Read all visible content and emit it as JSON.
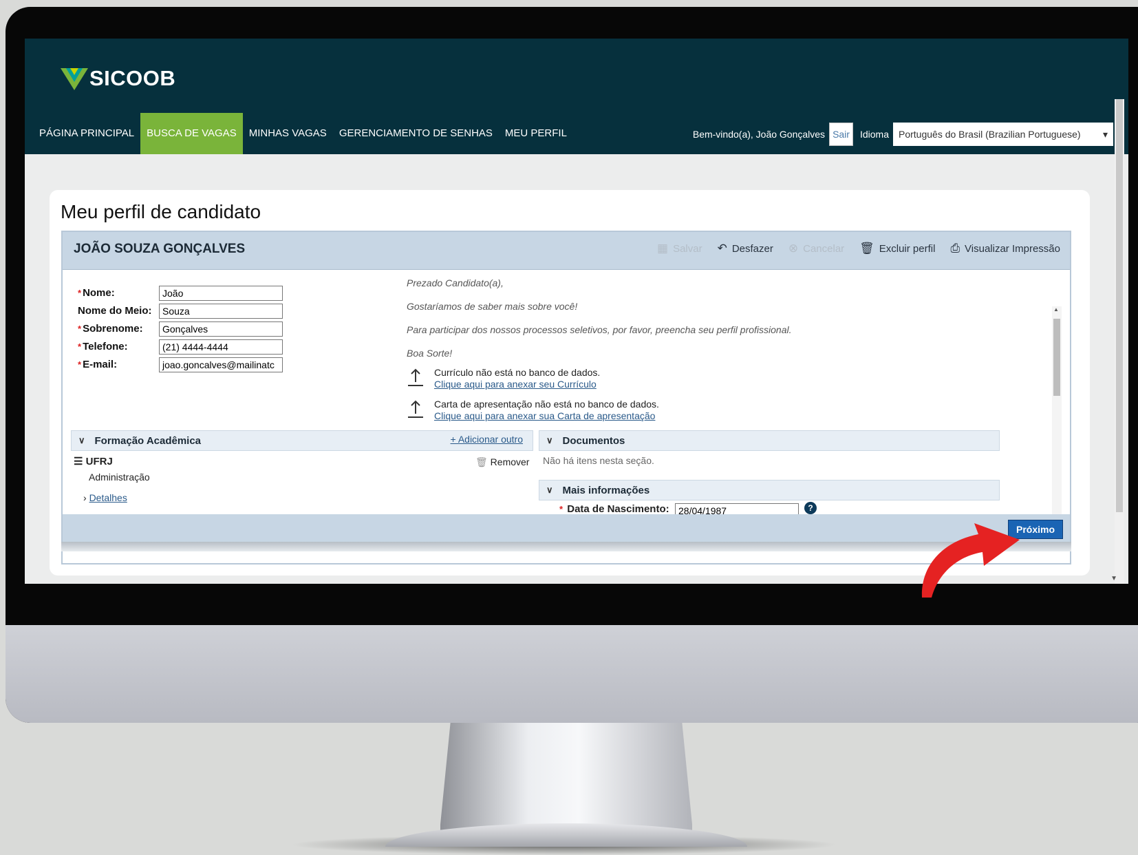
{
  "brand": {
    "name": "SICOOB"
  },
  "nav": {
    "items": [
      {
        "label": "PÁGINA PRINCIPAL"
      },
      {
        "label": "BUSCA DE VAGAS"
      },
      {
        "label": "MINHAS VAGAS"
      },
      {
        "label": "GERENCIAMENTO DE SENHAS"
      },
      {
        "label": "MEU PERFIL"
      }
    ],
    "active": "BUSCA DE VAGAS"
  },
  "user": {
    "welcome": "Bem-vindo(a), João Gonçalves",
    "logout_label": "Sair",
    "language_label": "Idioma",
    "language_value": "Português do Brasil (Brazilian Portuguese)"
  },
  "page": {
    "title": "Meu perfil de candidato"
  },
  "profile": {
    "candidate_name": "JOÃO SOUZA GONÇALVES",
    "toolbar": {
      "save": "Salvar",
      "undo": "Desfazer",
      "cancel": "Cancelar",
      "delete_profile": "Excluir perfil",
      "print_view": "Visualizar Impressão"
    },
    "fields": {
      "first_name": {
        "label": "Nome:",
        "value": "João",
        "required": true
      },
      "middle_name": {
        "label": "Nome do Meio:",
        "value": "Souza",
        "required": false
      },
      "last_name": {
        "label": "Sobrenome:",
        "value": "Gonçalves",
        "required": true
      },
      "phone": {
        "label": "Telefone:",
        "value": "(21) 4444-4444",
        "required": true
      },
      "email": {
        "label": "E-mail:",
        "value": "joao.goncalves@mailinatc",
        "required": true
      }
    },
    "intro": {
      "greeting": "Prezado Candidato(a),",
      "line1": "Gostaríamos de saber mais sobre você!",
      "line2": "Para participar dos nossos processos seletivos, por favor, preencha seu perfil profissional.",
      "line3": "Boa Sorte!"
    },
    "resume": {
      "status": "Currículo não está no banco de dados.",
      "link": "Clique aqui para anexar seu Currículo"
    },
    "cover_letter": {
      "status": "Carta de apresentação não está no banco de dados.",
      "link": "Clique aqui para anexar sua Carta de apresentação"
    },
    "education": {
      "title": "Formação Acadêmica",
      "add_label": "+ Adicionar outro",
      "item": {
        "institution": "UFRJ",
        "course": "Administração",
        "remove_label": "Remover",
        "details_label": "Detalhes"
      }
    },
    "documents": {
      "title": "Documentos",
      "empty": "Não há itens nesta seção."
    },
    "more_info": {
      "title": "Mais informações",
      "birth_label": "Data de Nascimento:",
      "birth_value": "28/04/1987"
    },
    "next_label": "Próximo"
  },
  "colors": {
    "topbar": "#06303d",
    "nav_active": "#7ab43a",
    "accent_button": "#1a64b4",
    "arrow": "#e52222"
  }
}
